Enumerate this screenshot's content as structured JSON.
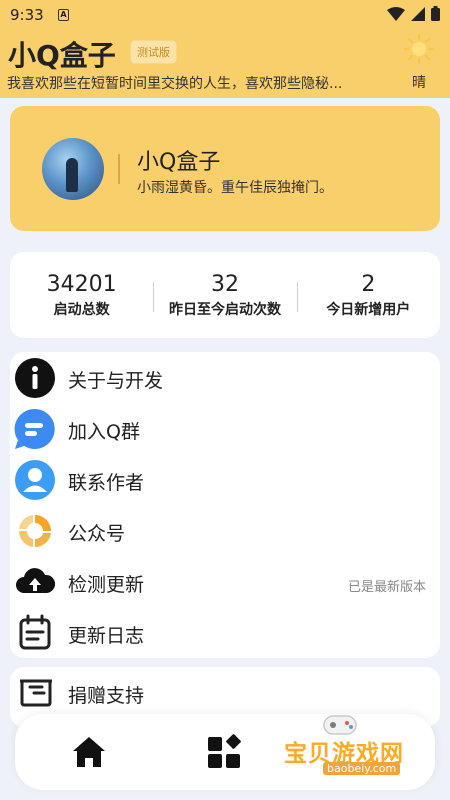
{
  "status": {
    "time": "9:33"
  },
  "header": {
    "title": "小Q盒子",
    "badge": "测试版",
    "subtitle": "我喜欢那些在短暂时间里交换的人生，喜欢那些隐秘...",
    "weather": "晴"
  },
  "profile": {
    "name": "小Q盒子",
    "motto": "小雨湿黄昏。重午佳辰独掩门。"
  },
  "stats": [
    {
      "value": "34201",
      "label": "启动总数"
    },
    {
      "value": "32",
      "label": "昨日至今启动次数"
    },
    {
      "value": "2",
      "label": "今日新增用户"
    }
  ],
  "menu": {
    "items": [
      {
        "label": "关于与开发",
        "icon": "info-icon"
      },
      {
        "label": "加入Q群",
        "icon": "chat-bubble-icon"
      },
      {
        "label": "联系作者",
        "icon": "user-icon"
      },
      {
        "label": "公众号",
        "icon": "wechat-official-icon"
      },
      {
        "label": "检测更新",
        "icon": "cloud-upload-icon",
        "right": "已是最新版本"
      },
      {
        "label": "更新日志",
        "icon": "calendar-icon"
      }
    ],
    "donate": {
      "label": "捐赠支持",
      "icon": "donate-icon"
    }
  },
  "watermark": {
    "text": "宝贝游戏网",
    "url": "baobeiy.com"
  },
  "colors": {
    "accent": "#f9cf6b",
    "background": "#eef1f8"
  }
}
